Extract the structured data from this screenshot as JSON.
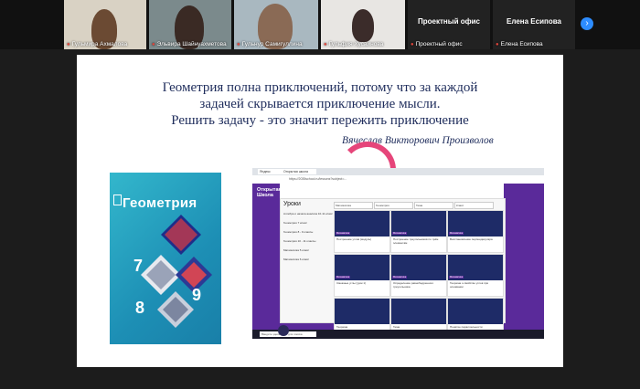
{
  "participants": [
    {
      "name": "Гульмира Ахмалова"
    },
    {
      "name": "Эльвира Шайнуахметова"
    },
    {
      "name": "Гульнур Самигуллина"
    },
    {
      "name": "Гульфия Хусаинова"
    },
    {
      "name": "Проектный офис",
      "big": "Проектный офис"
    },
    {
      "name": "Елена Есипова",
      "big": "Елена Есипова"
    }
  ],
  "slide": {
    "quote_line1": "Геометрия полна приключений,    потому что за каждой",
    "quote_line2": "задачей скрывается приключение мысли.",
    "quote_line3": "Решить задачу - это значит пережить приключение",
    "author": "Вячеслав Викторович Произволов"
  },
  "book": {
    "title": "Геометрия",
    "n7": "7",
    "n8": "8",
    "n9": "9"
  },
  "screen": {
    "tab1": "Яндекс",
    "tab2": "Открытая школа",
    "url": "https://2035school.ru/lessons?subject=...",
    "logo_line1": "Открытая",
    "logo_line2": "Школа",
    "panel_title": "Уроки",
    "side": [
      "Алгебра и начала анализа 10-11 класс",
      "Геометрия 7 класс",
      "Геометрия 8 - 9 классы",
      "Геометрия 10 - 11 классы",
      "Математика 5 класс",
      "Математика 6 класс"
    ],
    "filters": [
      "Математика",
      "Геометрия",
      "Тема",
      "Класс"
    ],
    "cards": [
      "Построение углов (модуль)",
      "Построение треугольников по трём элементам",
      "Восстановление перпендикуляра",
      "Смежные углы (урок 1)",
      "Определение равнобедренного треугольника",
      "Теорема о свойстве углов при основании",
      "Теорема",
      "Тема",
      "Понятие параллельности"
    ],
    "search": "Введите здесь текст для поиска"
  },
  "colors": {
    "brand_purple": "#5a2a9a",
    "quote_blue": "#1f2d5c",
    "zoom_blue": "#2d8cff"
  }
}
